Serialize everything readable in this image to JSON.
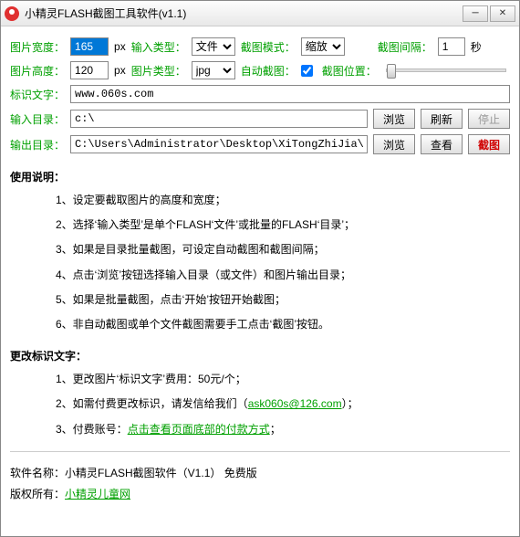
{
  "window": {
    "title": "小精灵FLASH截图工具软件(v1.1)"
  },
  "labels": {
    "imgWidth": "图片宽度：",
    "px1": "px",
    "inputType": "输入类型：",
    "captureMode": "截图模式：",
    "captureInterval": "截图间隔：",
    "second": "秒",
    "imgHeight": "图片高度：",
    "px2": "px",
    "imgType": "图片类型：",
    "autoCapture": "自动截图：",
    "capturePos": "截图位置：",
    "markText": "标识文字：",
    "inputDir": "输入目录：",
    "outputDir": "输出目录："
  },
  "values": {
    "width": "165",
    "height": "120",
    "inputType": "文件",
    "captureMode": "缩放",
    "interval": "1",
    "imgType": "jpg",
    "markText": "www.060s.com",
    "inputDir": "c:\\",
    "outputDir": "C:\\Users\\Administrator\\Desktop\\XiTongZhiJia\\"
  },
  "buttons": {
    "browse": "浏览",
    "refresh": "刷新",
    "stop": "停止",
    "view": "查看",
    "capture": "截图"
  },
  "help": {
    "usageTitle": "使用说明：",
    "u1": "1、设定要截取图片的高度和宽度；",
    "u2": "2、选择‘输入类型’是单个FLASH‘文件’或批量的FLASH‘目录’；",
    "u3": "3、如果是目录批量截图，可设定自动截图和截图间隔；",
    "u4": "4、点击‘浏览’按钮选择输入目录（或文件）和图片输出目录；",
    "u5": "5、如果是批量截图，点击‘开始’按钮开始截图；",
    "u6": "6、非自动截图或单个文件截图需要手工点击‘截图’按钮。",
    "changeTitle": "更改标识文字：",
    "c1": "1、更改图片‘标识文字’费用：50元/个；",
    "c2a": "2、如需付费更改标识，请发信给我们（",
    "c2link": "ask060s@126.com",
    "c2b": "）；",
    "c3a": "3、付费账号：",
    "c3link": "点击查看页面底部的付款方式",
    "c3b": "；"
  },
  "footer": {
    "name": "软件名称：小精灵FLASH截图软件（V1.1）  免费版",
    "copyLabel": "版权所有：",
    "copyLink": "小精灵儿童网"
  }
}
